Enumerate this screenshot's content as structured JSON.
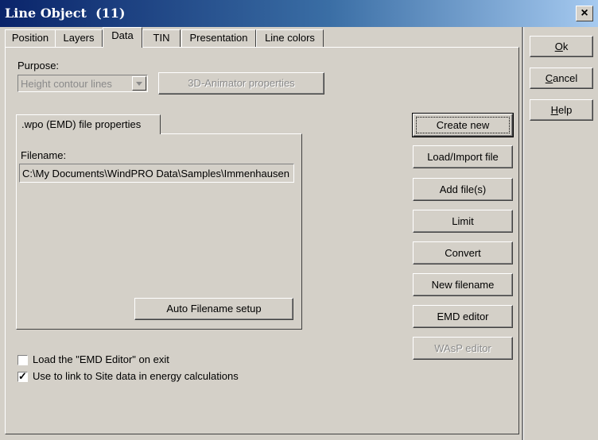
{
  "window": {
    "title": "Line Object  (11)"
  },
  "tabs": [
    {
      "label": "Position"
    },
    {
      "label": "Layers"
    },
    {
      "label": "Data"
    },
    {
      "label": "TIN"
    },
    {
      "label": "Presentation"
    },
    {
      "label": "Line colors"
    }
  ],
  "purpose": {
    "label": "Purpose:",
    "selected": "Height contour lines",
    "animator_button": "3D-Animator properties"
  },
  "file_props": {
    "tab_label": ".wpo (EMD) file properties",
    "filename_label": "Filename:",
    "filename_value": "C:\\My Documents\\WindPRO Data\\Samples\\Immenhausen",
    "auto_button": "Auto Filename setup"
  },
  "actions": {
    "create_new": "Create new",
    "load_import": "Load/Import file",
    "add_files": "Add file(s)",
    "limit": "Limit",
    "convert": "Convert",
    "new_filename": "New filename",
    "emd_editor": "EMD editor",
    "wasp_editor": "WAsP editor"
  },
  "options": {
    "load_emd_editor": {
      "label": "Load the \"EMD Editor\" on exit",
      "checked": false
    },
    "link_site_data": {
      "label": "Use to link to Site data in energy calculations",
      "checked": true
    }
  },
  "dialog": {
    "ok_rest": "k",
    "ok_key": "O",
    "cancel_key": "C",
    "cancel_rest": "ancel",
    "help_key": "H",
    "help_rest": "elp"
  },
  "icons": {
    "close": "close-icon",
    "dropdown": "chevron-down-icon",
    "check": "check-icon"
  }
}
